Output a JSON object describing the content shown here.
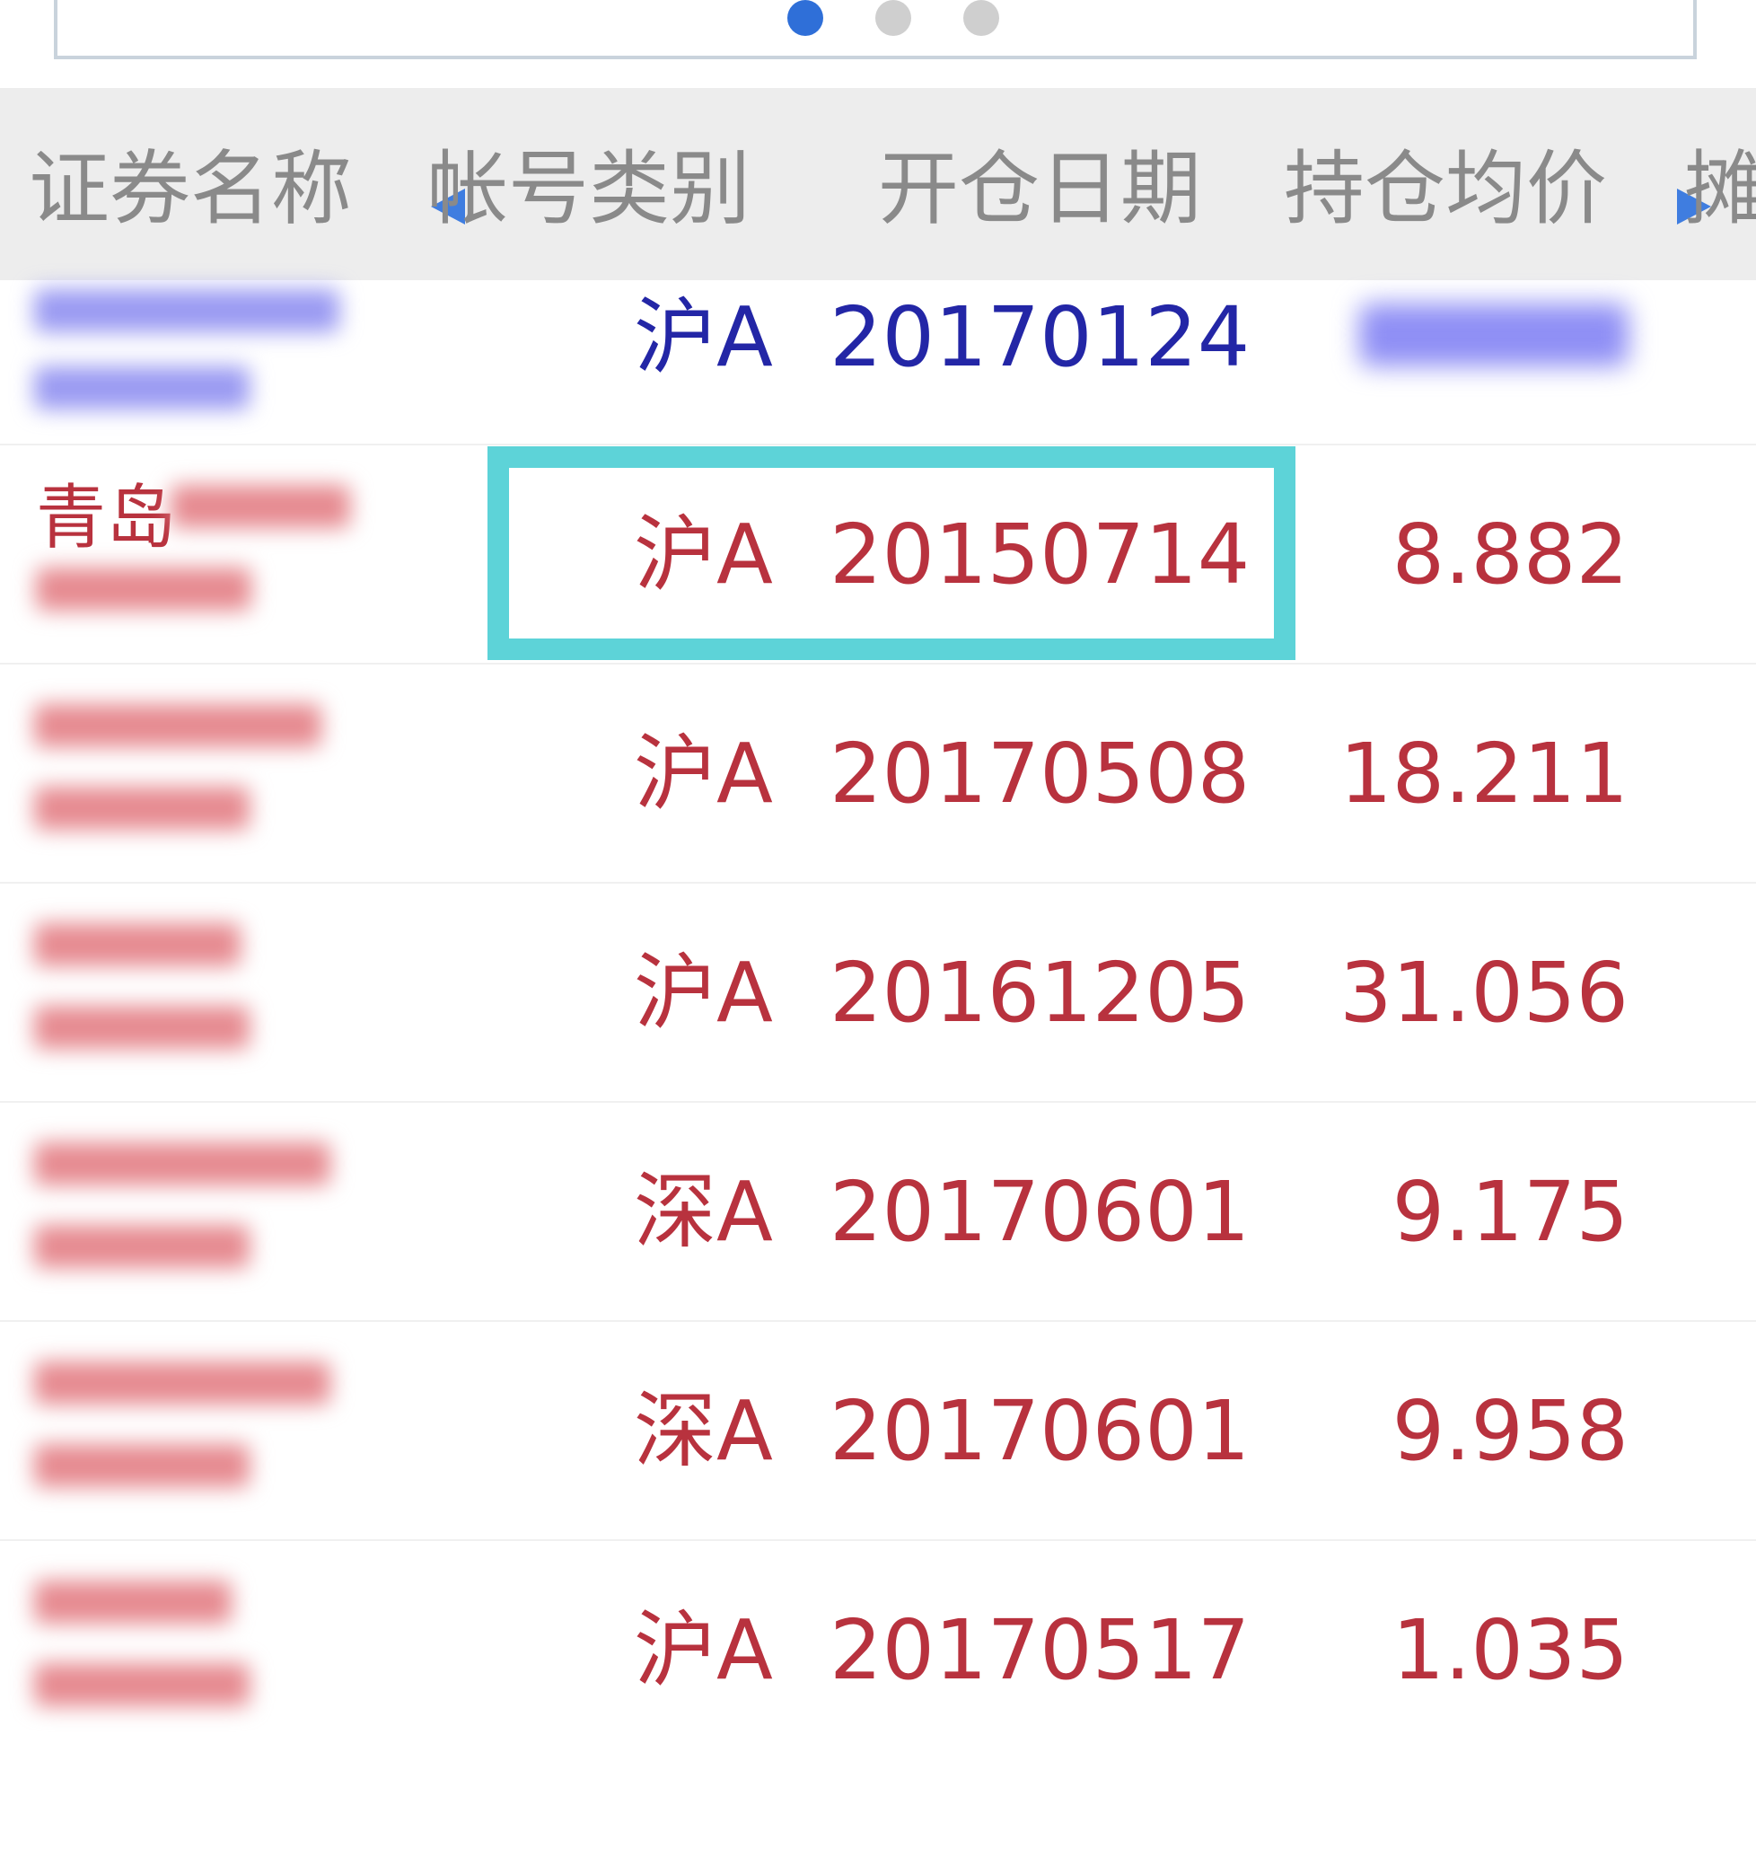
{
  "colors": {
    "header_bg": "#ededed",
    "header_text": "#8a8a8a",
    "up_red": "#b8323e",
    "down_blue": "#2326a6",
    "highlight": "#5dd3d8",
    "dot_active": "#2f6fd8",
    "dot_inactive": "#cfcfcf"
  },
  "pager": {
    "dots": 3,
    "active_index": 0
  },
  "header": {
    "columns": [
      "证券名称",
      "帐号类别",
      "开仓日期",
      "持仓均价",
      "摊"
    ],
    "left_arrow_icon": "caret-left-icon",
    "right_arrow_icon": "caret-right-icon"
  },
  "rows": [
    {
      "name": "",
      "type": "沪A",
      "date": "20170124",
      "price": "",
      "color": "down_blue"
    },
    {
      "name": "青岛",
      "type": "沪A",
      "date": "20150714",
      "price": "8.882",
      "color": "up_red",
      "highlighted": true
    },
    {
      "name": "",
      "type": "沪A",
      "date": "20170508",
      "price": "18.211",
      "color": "up_red"
    },
    {
      "name": "",
      "type": "沪A",
      "date": "20161205",
      "price": "31.056",
      "color": "up_red"
    },
    {
      "name": "",
      "type": "深A",
      "date": "20170601",
      "price": "9.175",
      "color": "up_red"
    },
    {
      "name": "",
      "type": "深A",
      "date": "20170601",
      "price": "9.958",
      "color": "up_red"
    },
    {
      "name": "",
      "type": "沪A",
      "date": "20170517",
      "price": "1.035",
      "color": "up_red"
    }
  ]
}
